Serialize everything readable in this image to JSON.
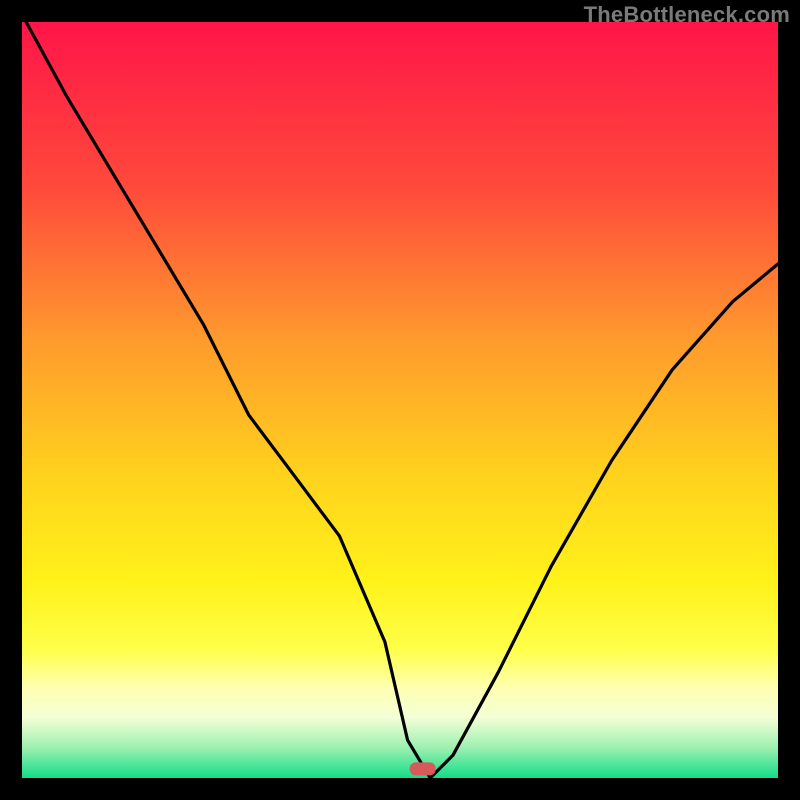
{
  "watermark": "TheBottleneck.com",
  "chart_data": {
    "type": "line",
    "title": "",
    "xlabel": "",
    "ylabel": "",
    "xlim": [
      0,
      100
    ],
    "ylim": [
      0,
      100
    ],
    "grid": false,
    "background_gradient": {
      "stops": [
        {
          "offset": 0.0,
          "color": "#ff1548"
        },
        {
          "offset": 0.22,
          "color": "#ff4a3b"
        },
        {
          "offset": 0.42,
          "color": "#ff9a2d"
        },
        {
          "offset": 0.6,
          "color": "#ffd21d"
        },
        {
          "offset": 0.74,
          "color": "#fff21a"
        },
        {
          "offset": 0.83,
          "color": "#ffff4a"
        },
        {
          "offset": 0.88,
          "color": "#ffffb0"
        },
        {
          "offset": 0.92,
          "color": "#f4ffd6"
        },
        {
          "offset": 0.96,
          "color": "#9cf0b0"
        },
        {
          "offset": 1.0,
          "color": "#12dd88"
        }
      ]
    },
    "series": [
      {
        "name": "bottleneck-curve",
        "x": [
          0,
          6,
          12,
          18,
          24,
          30,
          36,
          42,
          48,
          51,
          54,
          57,
          63,
          70,
          78,
          86,
          94,
          100
        ],
        "values": [
          101,
          90,
          80,
          70,
          60,
          48,
          40,
          32,
          18,
          5,
          0,
          3,
          14,
          28,
          42,
          54,
          63,
          68
        ]
      }
    ],
    "annotations": [
      {
        "name": "min-marker",
        "x": 53,
        "y": 1.2,
        "shape": "rounded-rect",
        "color": "#d65a5a"
      }
    ]
  }
}
